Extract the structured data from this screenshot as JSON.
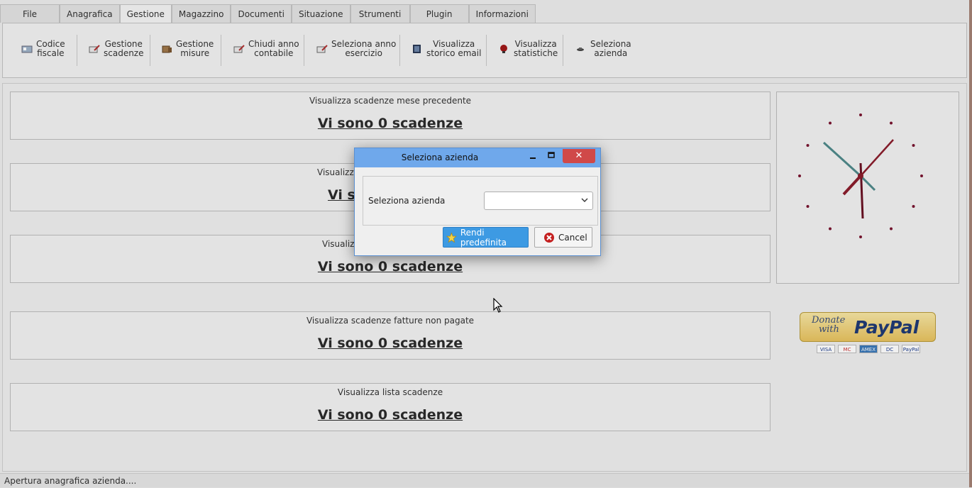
{
  "tabs": [
    {
      "label": "File"
    },
    {
      "label": "Anagrafica"
    },
    {
      "label": "Gestione"
    },
    {
      "label": "Magazzino"
    },
    {
      "label": "Documenti"
    },
    {
      "label": "Situazione"
    },
    {
      "label": "Strumenti"
    },
    {
      "label": "Plugin"
    },
    {
      "label": "Informazioni"
    }
  ],
  "active_tab": "Gestione",
  "ribbon": {
    "codice_fiscale": {
      "line1": "Codice",
      "line2": "fiscale"
    },
    "gestione_scadenze": {
      "line1": "Gestione",
      "line2": "scadenze"
    },
    "gestione_misure": {
      "line1": "Gestione",
      "line2": "misure"
    },
    "chiudi_anno": {
      "line1": "Chiudi anno",
      "line2": "contabile"
    },
    "seleziona_anno": {
      "line1": "Seleziona anno",
      "line2": "esercizio"
    },
    "storico_email": {
      "line1": "Visualizza",
      "line2": "storico email"
    },
    "statistiche": {
      "line1": "Visualizza",
      "line2": "statistiche"
    },
    "seleziona_azienda": {
      "line1": "Seleziona",
      "line2": "azienda"
    }
  },
  "panels": [
    {
      "title": "Visualizza scadenze mese precedente",
      "value": "Vi sono 0 scadenze"
    },
    {
      "title": "Visualizza",
      "value": "Vi so"
    },
    {
      "title": "Visualiz",
      "value": "Vi sono 0 scadenze"
    },
    {
      "title": "Visualizza scadenze fatture non pagate",
      "value": "Vi sono 0 scadenze"
    },
    {
      "title": "Visualizza lista scadenze",
      "value": "Vi sono 0 scadenze"
    }
  ],
  "paypal": {
    "donate_line1": "Donate",
    "donate_line2": "with",
    "logo": "PayPal",
    "cards": [
      "VISA",
      "MC",
      "AMEX",
      "DC",
      "PayPal"
    ]
  },
  "status_text": "Apertura anagrafica azienda....",
  "dialog": {
    "title": "Seleziona azienda",
    "field_label": "Seleziona azienda",
    "combo_value": "",
    "primary_button": "Rendi predefinita",
    "cancel_button": "Cancel"
  },
  "colors": {
    "titlebar": "#6fa8eb",
    "close_button": "#d04949",
    "primary_button": "#3d9ae3",
    "clock_hands": "#8b1d2c",
    "clock_second_hand": "#4f8a8b"
  }
}
